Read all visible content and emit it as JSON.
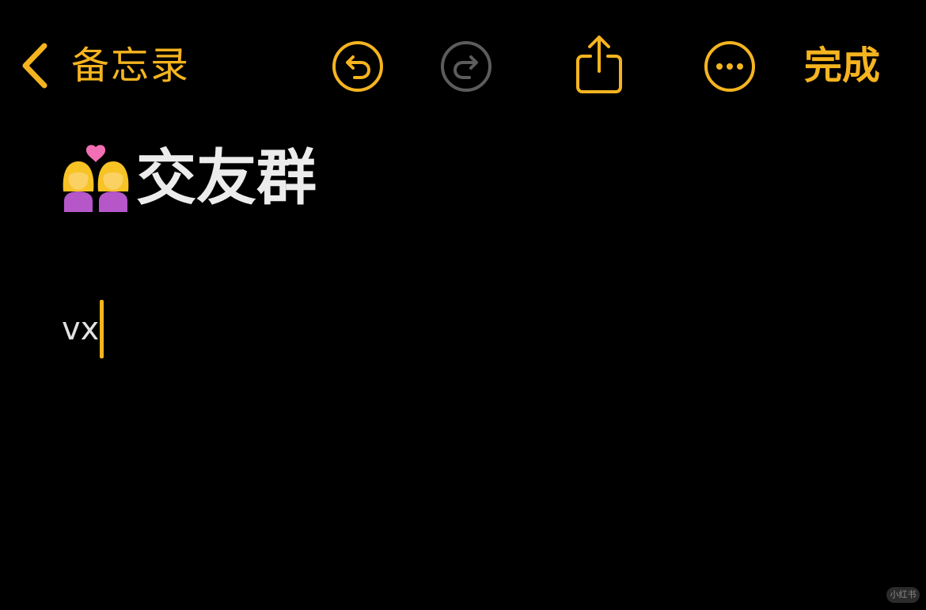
{
  "toolbar": {
    "back_label": "备忘录",
    "back_icon": "chevron-left-icon",
    "undo_icon": "undo-icon",
    "redo_icon": "redo-icon",
    "share_icon": "share-icon",
    "more_icon": "more-icon",
    "done_label": "完成"
  },
  "note": {
    "title_emoji_icon": "couple-with-heart-icon",
    "title": "交友群",
    "body": "vx"
  },
  "watermark": {
    "label": "小红书"
  },
  "colors": {
    "background": "#000000",
    "accent": "#f5b41f",
    "disabled": "#5c5c5c",
    "text": "#ececec"
  }
}
